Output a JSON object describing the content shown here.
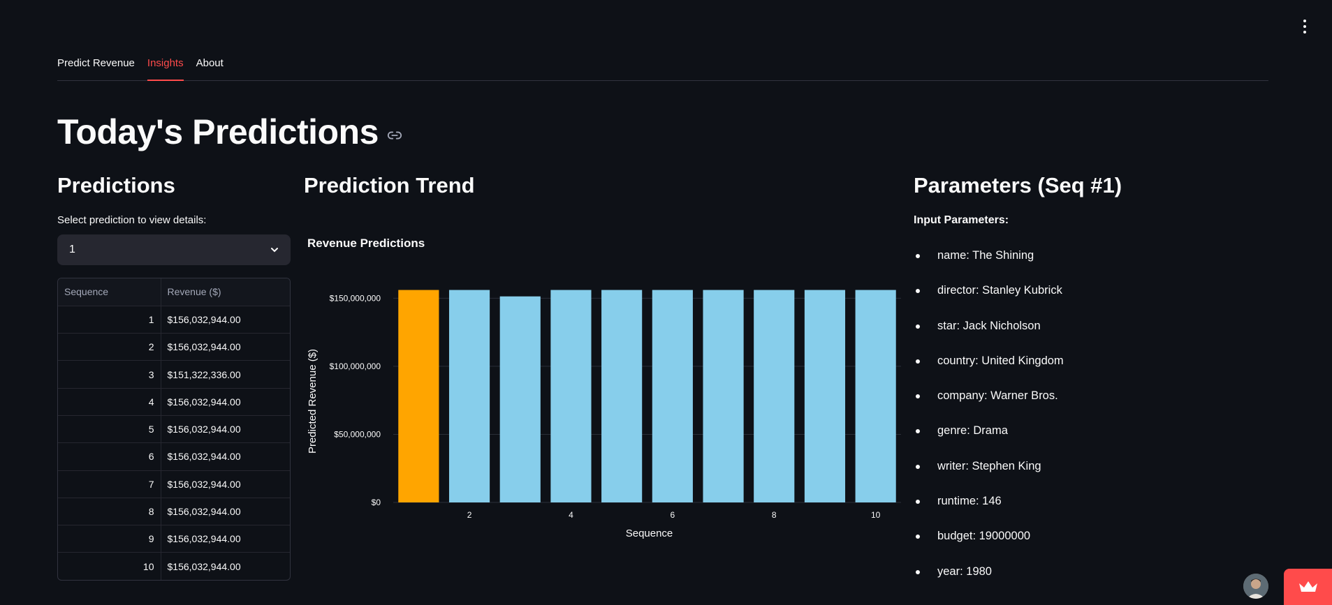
{
  "tabs": [
    {
      "label": "Predict Revenue",
      "active": false
    },
    {
      "label": "Insights",
      "active": true
    },
    {
      "label": "About",
      "active": false
    }
  ],
  "page_title": "Today's Predictions",
  "predictions": {
    "heading": "Predictions",
    "select_label": "Select prediction to view details:",
    "selected_value": "1",
    "table": {
      "columns": [
        "Sequence",
        "Revenue ($)"
      ],
      "rows": [
        [
          "1",
          "$156,032,944.00"
        ],
        [
          "2",
          "$156,032,944.00"
        ],
        [
          "3",
          "$151,322,336.00"
        ],
        [
          "4",
          "$156,032,944.00"
        ],
        [
          "5",
          "$156,032,944.00"
        ],
        [
          "6",
          "$156,032,944.00"
        ],
        [
          "7",
          "$156,032,944.00"
        ],
        [
          "8",
          "$156,032,944.00"
        ],
        [
          "9",
          "$156,032,944.00"
        ],
        [
          "10",
          "$156,032,944.00"
        ]
      ]
    }
  },
  "trend": {
    "heading": "Prediction Trend"
  },
  "chart_data": {
    "type": "bar",
    "title": "Revenue Predictions",
    "xlabel": "Sequence",
    "ylabel": "Predicted Revenue ($)",
    "categories": [
      1,
      2,
      3,
      4,
      5,
      6,
      7,
      8,
      9,
      10
    ],
    "values": [
      156032944,
      156032944,
      151322336,
      156032944,
      156032944,
      156032944,
      156032944,
      156032944,
      156032944,
      156032944
    ],
    "highlight_index": 0,
    "colors": {
      "highlight": "#ffa500",
      "default": "#87ceeb"
    },
    "x_ticks": [
      2,
      4,
      6,
      8,
      10
    ],
    "y_ticks": [
      0,
      50000000,
      100000000,
      150000000
    ],
    "y_tick_labels": [
      "$0",
      "$50,000,000",
      "$100,000,000",
      "$150,000,000"
    ],
    "ylim": [
      0,
      164000000
    ],
    "grid": true
  },
  "parameters": {
    "heading": "Parameters (Seq #1)",
    "label": "Input Parameters:",
    "items": [
      "name: The Shining",
      "director: Stanley Kubrick",
      "star: Jack Nicholson",
      "country: United Kingdom",
      "company: Warner Bros.",
      "genre: Drama",
      "writer: Stephen King",
      "runtime: 146",
      "budget: 19000000",
      "year: 1980"
    ]
  },
  "icons": {
    "menu": "kebab-menu-icon",
    "link": "link-icon",
    "chevron": "chevron-down-icon",
    "crown": "crown-icon"
  },
  "colors": {
    "background": "#0e1117",
    "accent": "#ff4b4b"
  }
}
